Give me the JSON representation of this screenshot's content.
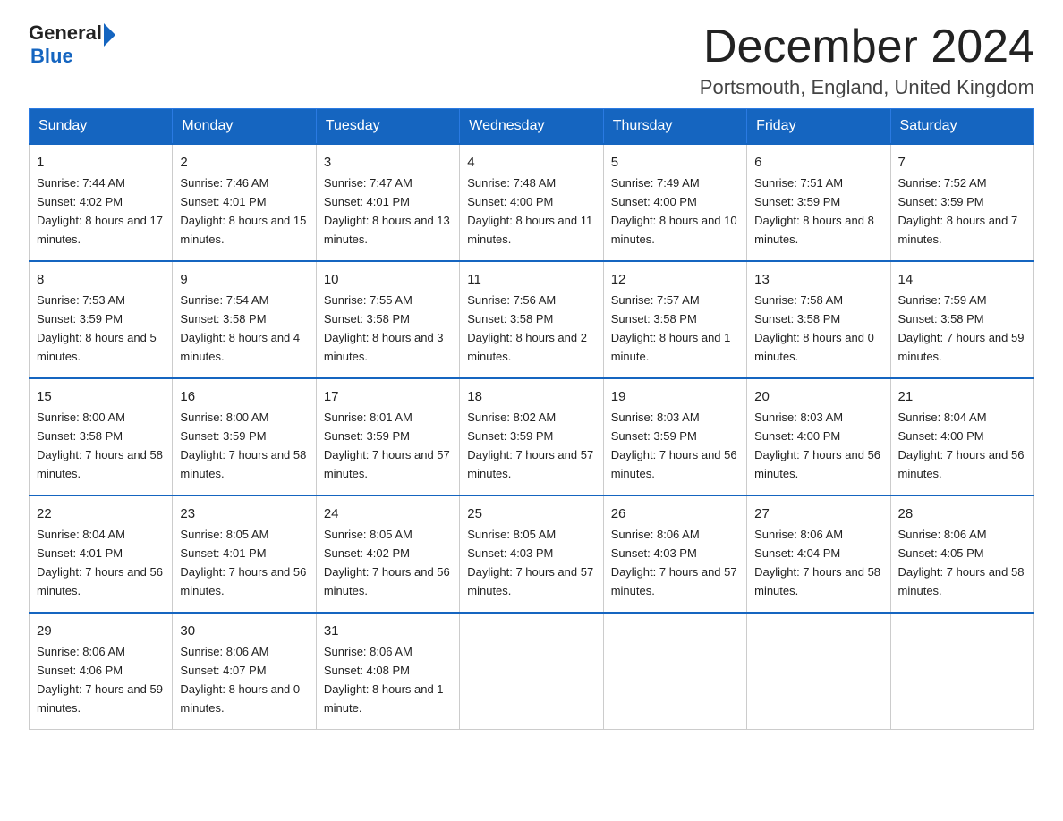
{
  "header": {
    "logo_general": "General",
    "logo_blue": "Blue",
    "month_title": "December 2024",
    "location": "Portsmouth, England, United Kingdom"
  },
  "weekdays": [
    "Sunday",
    "Monday",
    "Tuesday",
    "Wednesday",
    "Thursday",
    "Friday",
    "Saturday"
  ],
  "weeks": [
    [
      {
        "day": "1",
        "sunrise": "7:44 AM",
        "sunset": "4:02 PM",
        "daylight": "8 hours and 17 minutes."
      },
      {
        "day": "2",
        "sunrise": "7:46 AM",
        "sunset": "4:01 PM",
        "daylight": "8 hours and 15 minutes."
      },
      {
        "day": "3",
        "sunrise": "7:47 AM",
        "sunset": "4:01 PM",
        "daylight": "8 hours and 13 minutes."
      },
      {
        "day": "4",
        "sunrise": "7:48 AM",
        "sunset": "4:00 PM",
        "daylight": "8 hours and 11 minutes."
      },
      {
        "day": "5",
        "sunrise": "7:49 AM",
        "sunset": "4:00 PM",
        "daylight": "8 hours and 10 minutes."
      },
      {
        "day": "6",
        "sunrise": "7:51 AM",
        "sunset": "3:59 PM",
        "daylight": "8 hours and 8 minutes."
      },
      {
        "day": "7",
        "sunrise": "7:52 AM",
        "sunset": "3:59 PM",
        "daylight": "8 hours and 7 minutes."
      }
    ],
    [
      {
        "day": "8",
        "sunrise": "7:53 AM",
        "sunset": "3:59 PM",
        "daylight": "8 hours and 5 minutes."
      },
      {
        "day": "9",
        "sunrise": "7:54 AM",
        "sunset": "3:58 PM",
        "daylight": "8 hours and 4 minutes."
      },
      {
        "day": "10",
        "sunrise": "7:55 AM",
        "sunset": "3:58 PM",
        "daylight": "8 hours and 3 minutes."
      },
      {
        "day": "11",
        "sunrise": "7:56 AM",
        "sunset": "3:58 PM",
        "daylight": "8 hours and 2 minutes."
      },
      {
        "day": "12",
        "sunrise": "7:57 AM",
        "sunset": "3:58 PM",
        "daylight": "8 hours and 1 minute."
      },
      {
        "day": "13",
        "sunrise": "7:58 AM",
        "sunset": "3:58 PM",
        "daylight": "8 hours and 0 minutes."
      },
      {
        "day": "14",
        "sunrise": "7:59 AM",
        "sunset": "3:58 PM",
        "daylight": "7 hours and 59 minutes."
      }
    ],
    [
      {
        "day": "15",
        "sunrise": "8:00 AM",
        "sunset": "3:58 PM",
        "daylight": "7 hours and 58 minutes."
      },
      {
        "day": "16",
        "sunrise": "8:00 AM",
        "sunset": "3:59 PM",
        "daylight": "7 hours and 58 minutes."
      },
      {
        "day": "17",
        "sunrise": "8:01 AM",
        "sunset": "3:59 PM",
        "daylight": "7 hours and 57 minutes."
      },
      {
        "day": "18",
        "sunrise": "8:02 AM",
        "sunset": "3:59 PM",
        "daylight": "7 hours and 57 minutes."
      },
      {
        "day": "19",
        "sunrise": "8:03 AM",
        "sunset": "3:59 PM",
        "daylight": "7 hours and 56 minutes."
      },
      {
        "day": "20",
        "sunrise": "8:03 AM",
        "sunset": "4:00 PM",
        "daylight": "7 hours and 56 minutes."
      },
      {
        "day": "21",
        "sunrise": "8:04 AM",
        "sunset": "4:00 PM",
        "daylight": "7 hours and 56 minutes."
      }
    ],
    [
      {
        "day": "22",
        "sunrise": "8:04 AM",
        "sunset": "4:01 PM",
        "daylight": "7 hours and 56 minutes."
      },
      {
        "day": "23",
        "sunrise": "8:05 AM",
        "sunset": "4:01 PM",
        "daylight": "7 hours and 56 minutes."
      },
      {
        "day": "24",
        "sunrise": "8:05 AM",
        "sunset": "4:02 PM",
        "daylight": "7 hours and 56 minutes."
      },
      {
        "day": "25",
        "sunrise": "8:05 AM",
        "sunset": "4:03 PM",
        "daylight": "7 hours and 57 minutes."
      },
      {
        "day": "26",
        "sunrise": "8:06 AM",
        "sunset": "4:03 PM",
        "daylight": "7 hours and 57 minutes."
      },
      {
        "day": "27",
        "sunrise": "8:06 AM",
        "sunset": "4:04 PM",
        "daylight": "7 hours and 58 minutes."
      },
      {
        "day": "28",
        "sunrise": "8:06 AM",
        "sunset": "4:05 PM",
        "daylight": "7 hours and 58 minutes."
      }
    ],
    [
      {
        "day": "29",
        "sunrise": "8:06 AM",
        "sunset": "4:06 PM",
        "daylight": "7 hours and 59 minutes."
      },
      {
        "day": "30",
        "sunrise": "8:06 AM",
        "sunset": "4:07 PM",
        "daylight": "8 hours and 0 minutes."
      },
      {
        "day": "31",
        "sunrise": "8:06 AM",
        "sunset": "4:08 PM",
        "daylight": "8 hours and 1 minute."
      },
      null,
      null,
      null,
      null
    ]
  ],
  "labels": {
    "sunrise": "Sunrise:",
    "sunset": "Sunset:",
    "daylight": "Daylight:"
  }
}
